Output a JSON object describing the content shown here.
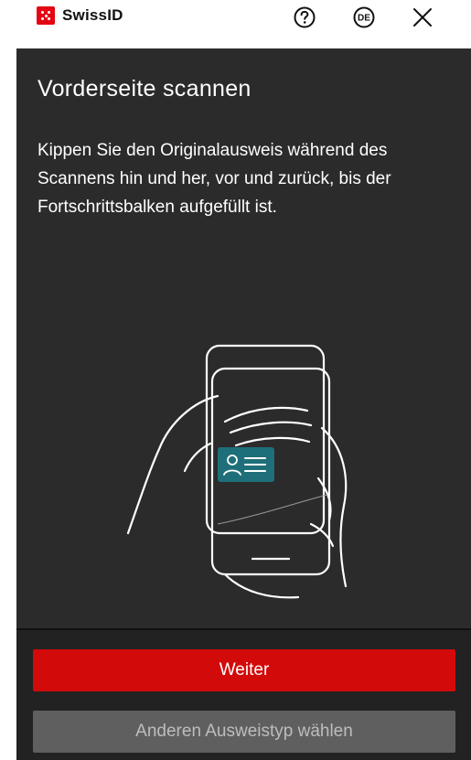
{
  "header": {
    "brand": "SwissID",
    "brand_color": "#e30613",
    "help_icon": "question-circle-icon",
    "language": "DE",
    "close_icon": "close-x-icon"
  },
  "main": {
    "title": "Vorderseite scannen",
    "description": "Kippen Sie den Originalausweis während des Scannens hin und her, vor und zurück, bis der Fortschrittsbalken aufgefüllt ist.",
    "illustration_icon": "hands-holding-phone-scanning-id-card-icon",
    "accent_color": "#1f6f7a"
  },
  "footer": {
    "primary_label": "Weiter",
    "primary_color": "#d30a0a",
    "secondary_label": "Anderen Ausweistyp wählen"
  }
}
